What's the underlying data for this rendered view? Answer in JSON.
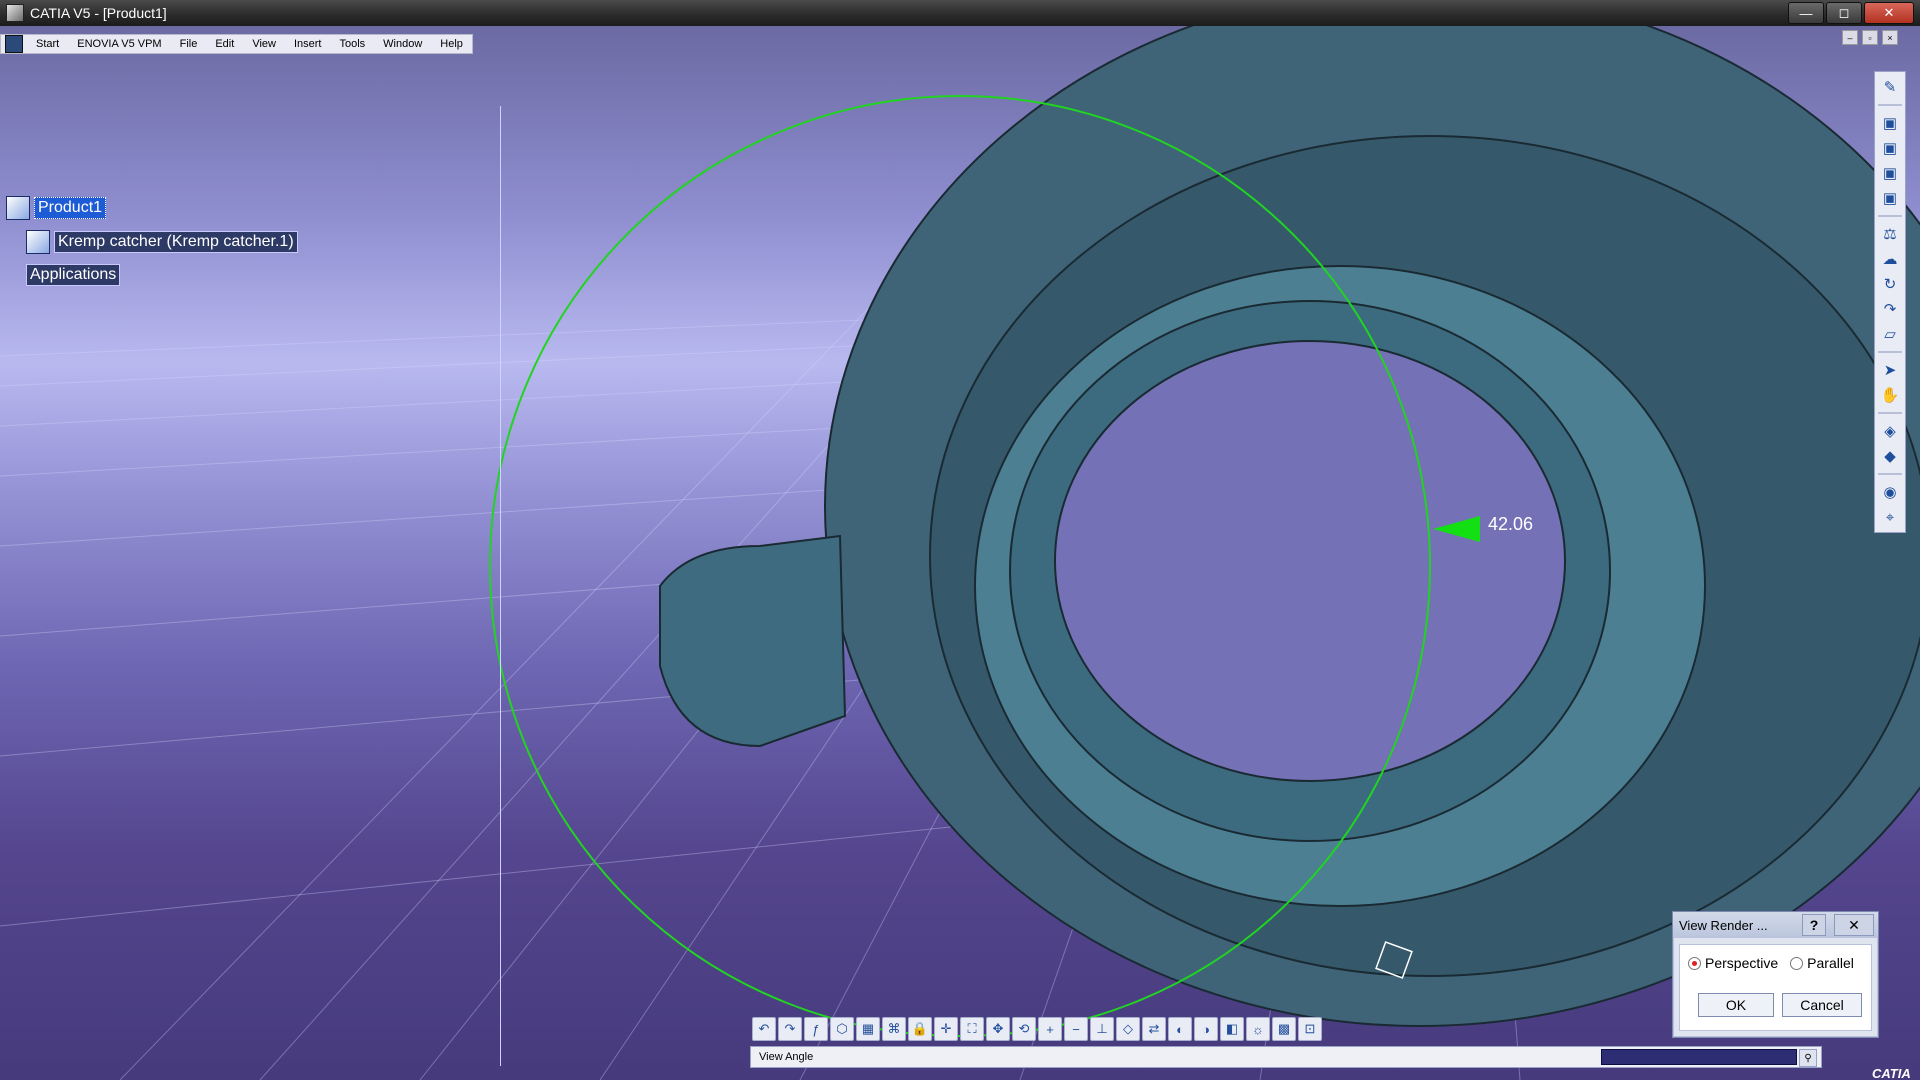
{
  "window": {
    "title": "CATIA V5 - [Product1]",
    "controls": [
      "—",
      "◻",
      "✕"
    ]
  },
  "menubar": {
    "items": [
      "Start",
      "ENOVIA V5 VPM",
      "File",
      "Edit",
      "View",
      "Insert",
      "Tools",
      "Window",
      "Help"
    ],
    "mdi_controls": [
      "–",
      "▫",
      "×"
    ]
  },
  "tree": {
    "root": "Product1",
    "child": "Kremp catcher (Kremp catcher.1)",
    "applications": "Applications"
  },
  "viewport": {
    "dimension_value": "42.06"
  },
  "right_toolbar": {
    "icons": [
      "sketch-icon",
      "view-1-icon",
      "view-2-icon",
      "view-3-icon",
      "view-4-icon",
      "measure-icon",
      "cloud-icon",
      "rotate-icon",
      "arrow-icon",
      "eraser-icon",
      "select-icon",
      "pointer-icon",
      "analysis-icon",
      "render-icon",
      "material-icon",
      "eye-icon",
      "snap-icon"
    ]
  },
  "bottom_toolbar": {
    "icons": [
      "undo-icon",
      "redo-icon",
      "formula-icon",
      "cube-icon",
      "table-icon",
      "hierarchy-icon",
      "lock-icon",
      "compass-icon",
      "fit-all-icon",
      "pan-icon",
      "rotate-view-icon",
      "zoom-in-icon",
      "zoom-out-icon",
      "normal-view-icon",
      "iso-view-icon",
      "swap-view-icon",
      "hide-icon",
      "show-icon",
      "render-mode-icon",
      "light-icon",
      "material-palette-icon",
      "camera-icon"
    ]
  },
  "status": {
    "text": "View Angle"
  },
  "dialog": {
    "title": "View Render ...",
    "help": "?",
    "close": "✕",
    "perspective_label": "Perspective",
    "parallel_label": "Parallel",
    "perspective_selected": true,
    "ok_label": "OK",
    "cancel_label": "Cancel"
  },
  "logo": {
    "text": "CATIA"
  }
}
